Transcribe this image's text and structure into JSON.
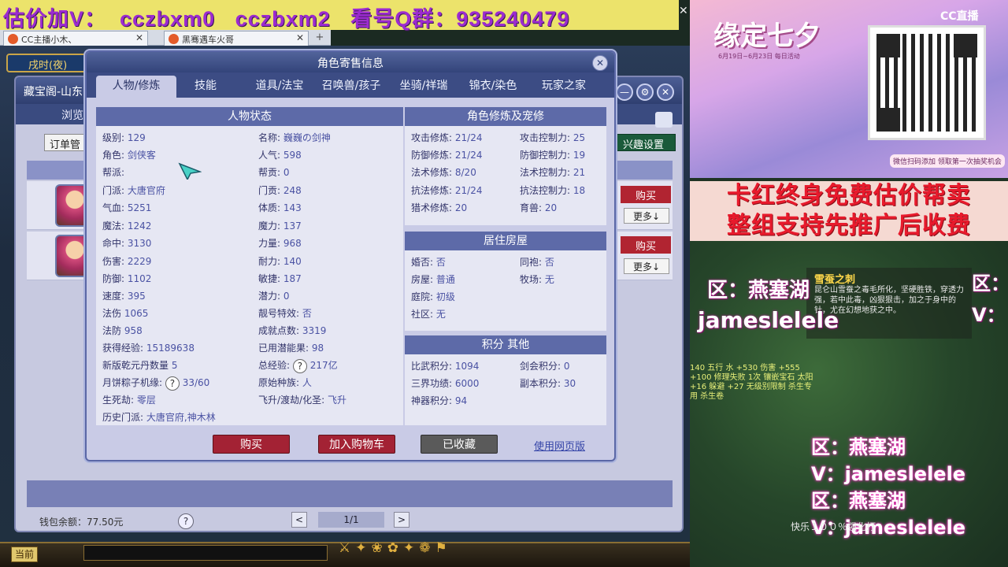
{
  "banner": {
    "part1": "估价加V：",
    "part2": "cczbxm0",
    "part3": "cczbxm2",
    "part4": "看号Q群：",
    "part5": "935240479",
    "close": "✕"
  },
  "browser_tabs": [
    {
      "label": "CC主播小木、",
      "close": "✕"
    },
    {
      "label": "黑骞遇车火哥",
      "close": "✕"
    }
  ],
  "game": {
    "time_label": "戌时(夜)",
    "back_window": {
      "title": "藏宝阁-山东",
      "nav_label": "浏览",
      "order_button": "订单管",
      "interest_button": "兴趣设置",
      "buy_label": "购买",
      "more_label": "更多↓",
      "wallet": "钱包余额：77.50元",
      "help": "?",
      "pager": {
        "prev": "<",
        "text": "1/1",
        "next": ">"
      },
      "controls": [
        "—",
        "⚙",
        "✕"
      ]
    },
    "bottom": {
      "current_button": "当前",
      "icons": "⚔✦❀✿✦❁⚑"
    }
  },
  "dialog": {
    "title": "角色寄售信息",
    "close": "✕",
    "tabs": [
      "人物/修炼",
      "技能",
      "道具/法宝",
      "召唤兽/孩子",
      "坐骑/祥瑞",
      "锦衣/染色",
      "玩家之家"
    ],
    "active_tab": "人物/修炼",
    "status_panel": {
      "title": "人物状态",
      "left": [
        {
          "k": "级别:",
          "v": "129"
        },
        {
          "k": "角色:",
          "v": "剑侠客"
        },
        {
          "k": "帮派:",
          "v": ""
        },
        {
          "k": "门派:",
          "v": "大唐官府"
        },
        {
          "k": "气血:",
          "v": "5251"
        },
        {
          "k": "魔法:",
          "v": "1242"
        },
        {
          "k": "命中:",
          "v": "3130"
        },
        {
          "k": "伤害:",
          "v": "2229"
        },
        {
          "k": "防御:",
          "v": "1102"
        },
        {
          "k": "速度:",
          "v": "395"
        },
        {
          "k": "法伤",
          "v": "1065"
        },
        {
          "k": "法防",
          "v": "958"
        }
      ],
      "right": [
        {
          "k": "名称:",
          "v": "巍巍の剑神"
        },
        {
          "k": "人气:",
          "v": "598"
        },
        {
          "k": "帮贡:",
          "v": "0"
        },
        {
          "k": "门贡:",
          "v": "248"
        },
        {
          "k": "体质:",
          "v": "143"
        },
        {
          "k": "魔力:",
          "v": "137"
        },
        {
          "k": "力量:",
          "v": "968"
        },
        {
          "k": "耐力:",
          "v": "140"
        },
        {
          "k": "敏捷:",
          "v": "187"
        },
        {
          "k": "潜力:",
          "v": "0"
        },
        {
          "k": "靓号特效:",
          "v": "否"
        },
        {
          "k": "成就点数:",
          "v": "3319"
        }
      ],
      "bottom_left": [
        {
          "k": "获得经验:",
          "v": "15189638"
        },
        {
          "k": "新版乾元丹数量",
          "v": "5"
        },
        {
          "k": "月饼粽子机缘:",
          "v": "33/60"
        },
        {
          "k": "生死劫:",
          "v": "零层"
        },
        {
          "k": "历史门派:",
          "v": "大唐官府,神木林"
        }
      ],
      "bottom_right": [
        {
          "k": "已用潜能果:",
          "v": "98"
        },
        {
          "k": "总经验:",
          "v": "217亿"
        },
        {
          "k": "原始种族:",
          "v": "人"
        },
        {
          "k": "飞升/渡劫/化圣:",
          "v": "飞升"
        }
      ],
      "help": "?"
    },
    "cultivation_panel": {
      "title": "角色修炼及宠修",
      "rows": [
        {
          "k1": "攻击修炼:",
          "v1": "21/24",
          "k2": "攻击控制力:",
          "v2": "25"
        },
        {
          "k1": "防御修炼:",
          "v1": "21/24",
          "k2": "防御控制力:",
          "v2": "19"
        },
        {
          "k1": "法术修炼:",
          "v1": "8/20",
          "k2": "法术控制力:",
          "v2": "21"
        },
        {
          "k1": "抗法修炼:",
          "v1": "21/24",
          "k2": "抗法控制力:",
          "v2": "18"
        },
        {
          "k1": "猎术修炼:",
          "v1": "20",
          "k2": "育兽:",
          "v2": "20"
        }
      ]
    },
    "housing_panel": {
      "title": "居住房屋",
      "rows": [
        {
          "k1": "婚否:",
          "v1": "否",
          "k2": "同袍:",
          "v2": "否"
        },
        {
          "k1": "房屋:",
          "v1": "普通",
          "k2": "牧场:",
          "v2": "无"
        },
        {
          "k1": "庭院:",
          "v1": "初级",
          "k2": "",
          "v2": ""
        },
        {
          "k1": "社区:",
          "v1": "无",
          "k2": "",
          "v2": ""
        }
      ]
    },
    "points_panel": {
      "title": "积分 其他",
      "rows": [
        {
          "k1": "比武积分:",
          "v1": "1094",
          "k2": "剑会积分:",
          "v2": "0"
        },
        {
          "k1": "三界功绩:",
          "v1": "6000",
          "k2": "副本积分:",
          "v2": "30"
        },
        {
          "k1": "神器积分:",
          "v1": "94",
          "k2": "",
          "v2": ""
        }
      ]
    },
    "buttons": {
      "buy": "购买",
      "add_cart": "加入购物车",
      "favorited": "已收藏",
      "web_link": "使用网页版"
    }
  },
  "stream": {
    "event_title": "缘定七夕",
    "event_sub": "6月19日~6月23日 每日活动",
    "cc_logo": "CC直播",
    "event_hint": "微信扫码添加 领取第一次抽奖机会",
    "line1": "卡红终身免费估价帮卖",
    "line2": "整组支持先推广后收费",
    "map_title": "雪蚕之刺",
    "map_text": "昆仑山雪蚕之毒毛所化，坚硬胜铁，穿透力强，若中此毒，凶狠狠击，加之于身中的针，尤在幻想地获之中。",
    "stats_text": "140 五行 水 +530 伤害 +555 +100 修理失败 1次 镶嵌宝石 太阳 +16 躲避 +27 无级别限制 杀生专用 杀生卷",
    "overlay": {
      "region_a": "区：燕塞湖",
      "id_a": "jameslelele",
      "region_b": "区：燕塞湖",
      "v_b": "V：jameslelele",
      "region_c": "区：燕塞湖",
      "v_c": "V：jameslelele",
      "corner_region": "区：",
      "corner_v": "V："
    },
    "footer": "快乐１００％强化打"
  }
}
